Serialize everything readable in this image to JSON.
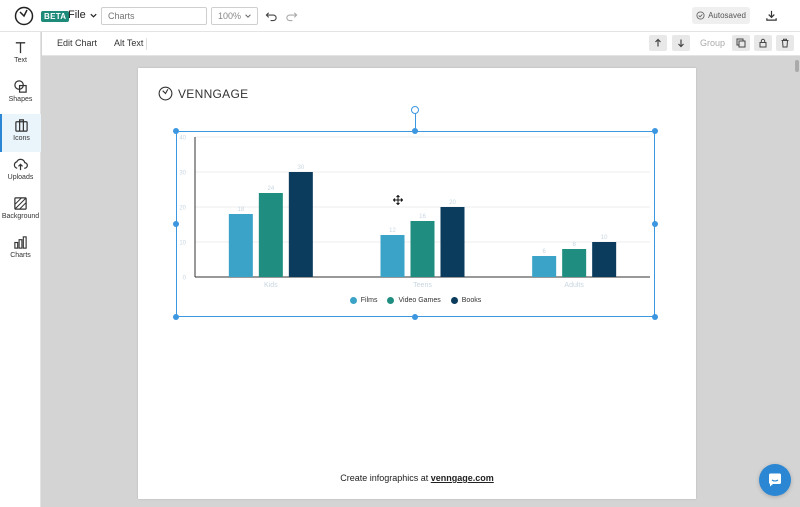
{
  "topbar": {
    "beta": "BETA",
    "file_menu": "File",
    "name_placeholder": "Charts",
    "zoom": "100%",
    "autosaved": "Autosaved"
  },
  "sidebar": {
    "items": [
      {
        "label": "Text",
        "icon": "text-icon"
      },
      {
        "label": "Shapes",
        "icon": "shapes-icon"
      },
      {
        "label": "Icons",
        "icon": "icons-icon"
      },
      {
        "label": "Uploads",
        "icon": "upload-icon"
      },
      {
        "label": "Background",
        "icon": "background-icon"
      },
      {
        "label": "Charts",
        "icon": "charts-icon"
      }
    ],
    "active_index": 2
  },
  "toolbar2": {
    "edit_chart": "Edit Chart",
    "alt_text": "Alt Text",
    "group": "Group"
  },
  "canvas": {
    "brand": "VENNGAGE",
    "footer_text": "Create infographics at ",
    "footer_link": "venngage.com"
  },
  "colors": {
    "accent": "#2b87d3",
    "selection": "#3c97e0",
    "films": "#3ba3c8",
    "video_games": "#1f8e80",
    "books": "#0b3c5d"
  },
  "chart_data": {
    "type": "bar",
    "categories": [
      "Kids",
      "Teens",
      "Adults"
    ],
    "series": [
      {
        "name": "Films",
        "values": [
          18,
          12,
          6
        ]
      },
      {
        "name": "Video Games",
        "values": [
          24,
          16,
          8
        ]
      },
      {
        "name": "Books",
        "values": [
          30,
          20,
          10
        ]
      }
    ],
    "yticks": [
      0,
      10,
      20,
      30,
      40
    ],
    "ylim": [
      0,
      40
    ],
    "grid": true,
    "legend": "bottom"
  }
}
